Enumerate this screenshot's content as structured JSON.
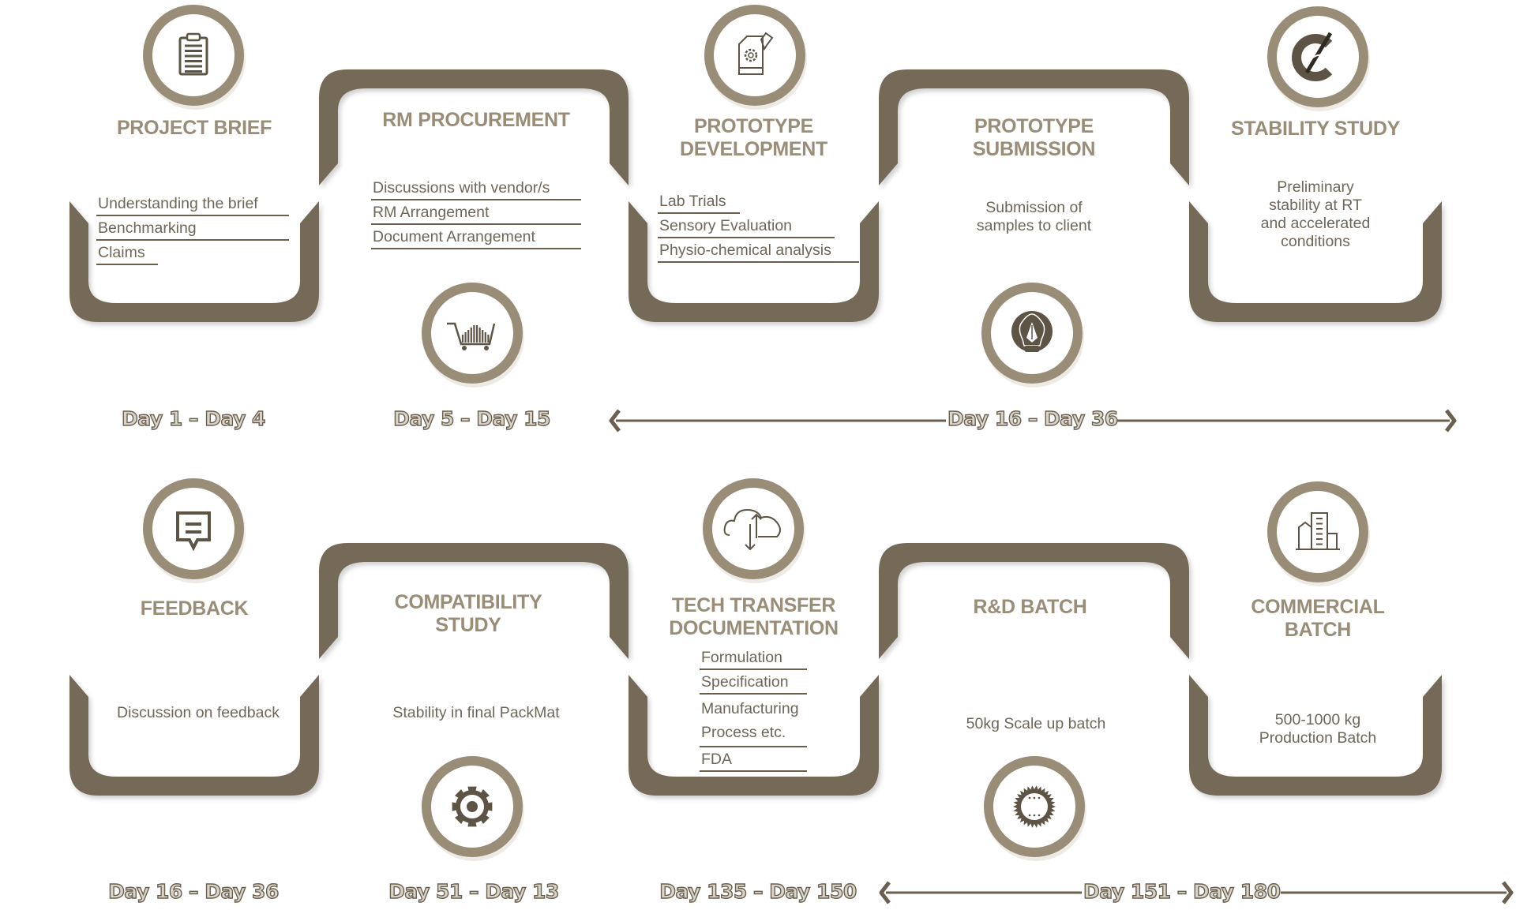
{
  "colors": {
    "track": "#746a58",
    "track_shadow": "#5e5546",
    "ring": "#9a8d78",
    "title": "#9a8d78",
    "text": "#6f665a",
    "icon": "#5e5446",
    "day_fill": "#d9d4ca",
    "day_stroke": "#6b5f4e"
  },
  "rows": [
    {
      "stages": [
        {
          "title": "PROJECT BRIEF",
          "icon": "clipboard-icon",
          "items": [
            "Understanding the brief",
            "Benchmarking",
            "Claims"
          ]
        },
        {
          "title": "RM PROCUREMENT",
          "icon": "shopping-cart-icon",
          "items": [
            "Discussions with vendor/s",
            "RM Arrangement",
            "Document Arrangement"
          ]
        },
        {
          "title_lines": [
            "PROTOTYPE",
            "DEVELOPMENT"
          ],
          "icon": "document-gear-pencil-icon",
          "items": [
            "Lab Trials",
            "Sensory Evaluation",
            "Physio-chemical analysis"
          ]
        },
        {
          "title_lines": [
            "PROTOTYPE",
            "SUBMISSION"
          ],
          "icon": "lightbulb-pen-icon",
          "desc_lines": [
            "Submission of",
            "samples to client"
          ]
        },
        {
          "title": "STABILITY STUDY",
          "icon": "hand-pencil-cycle-icon",
          "desc_lines": [
            "Preliminary",
            "stability at RT",
            "and accelerated",
            "conditions"
          ]
        }
      ],
      "days": [
        "Day 1 – Day 4",
        "Day 5 – Day 15",
        "Day 16 – Day 36"
      ]
    },
    {
      "stages": [
        {
          "title": "FEEDBACK",
          "icon": "speech-bubble-icon",
          "desc_lines": [
            "Discussion on feedback"
          ]
        },
        {
          "title_lines": [
            "COMPATIBILITY",
            "STUDY"
          ],
          "icon": "gear-icon",
          "desc_lines": [
            "Stability in final PackMat"
          ]
        },
        {
          "title_lines": [
            "TECH TRANSFER",
            "DOCUMENTATION"
          ],
          "icon": "cloud-transfer-icon",
          "items": [
            "Formulation",
            "Specification",
            "Manufacturing Process etc.",
            "FDA"
          ]
        },
        {
          "title": "R&D BATCH",
          "icon": "seal-badge-icon",
          "desc_lines": [
            "50kg Scale up batch"
          ]
        },
        {
          "title_lines": [
            "COMMERCIAL",
            "BATCH"
          ],
          "icon": "buildings-icon",
          "desc_lines": [
            "500-1000 kg",
            "Production Batch"
          ]
        }
      ],
      "days": [
        "Day 16 – Day 36",
        "Day 51 – Day 13",
        "Day 135 – Day 150",
        "Day 151 – Day 180"
      ]
    }
  ]
}
